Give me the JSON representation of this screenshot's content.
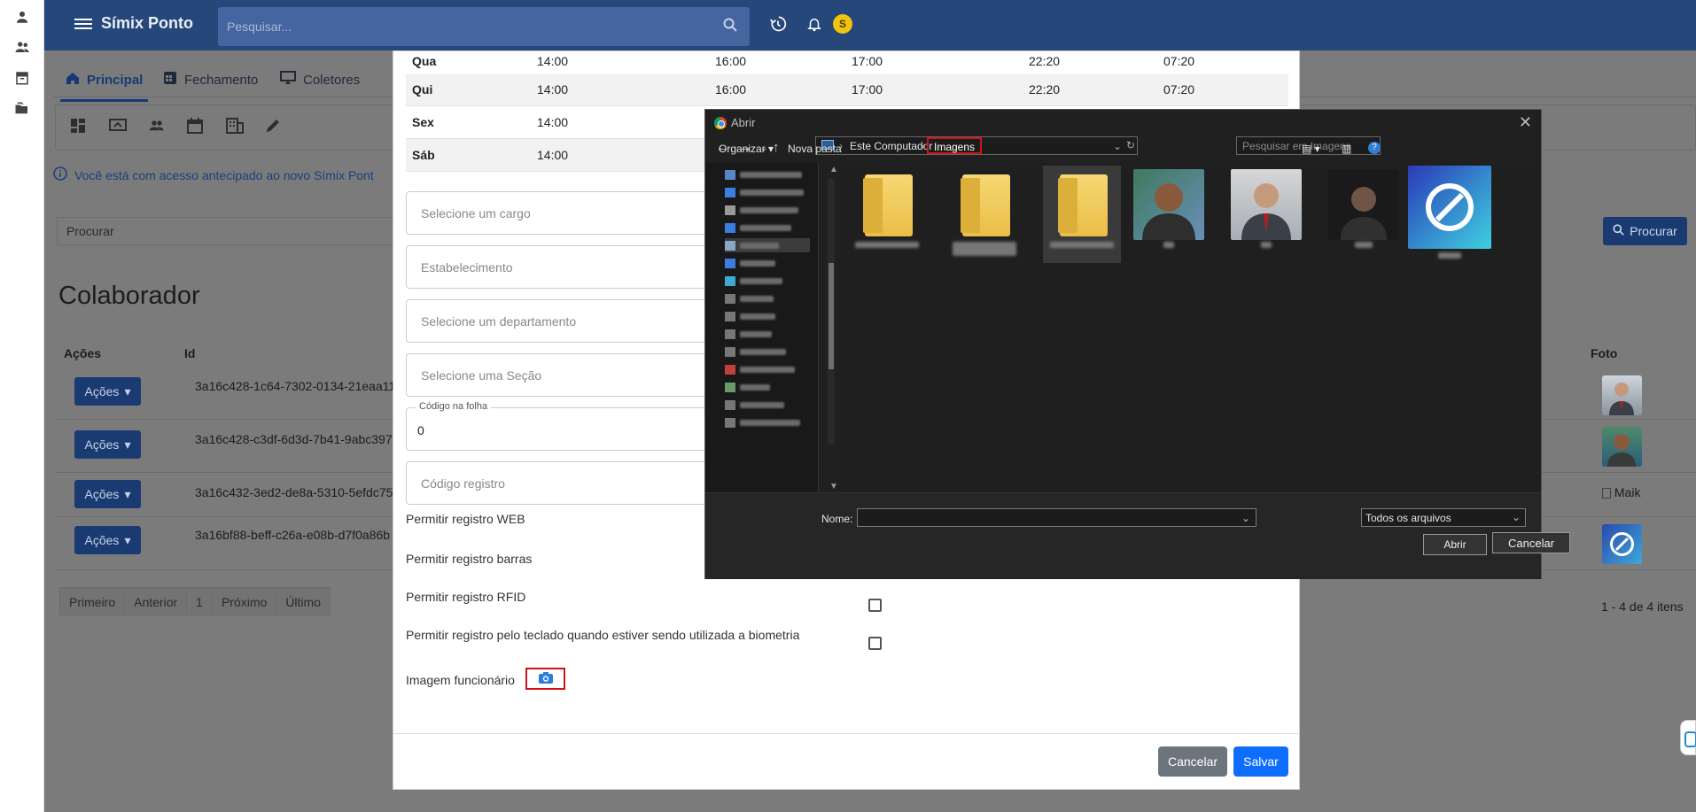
{
  "rail": {
    "icons": [
      "person-icon",
      "people-icon",
      "archive-icon",
      "folders-icon"
    ]
  },
  "topbar": {
    "brand": "Símix Ponto",
    "search_placeholder": "Pesquisar...",
    "avatar_letter": "S",
    "brand_color": "#25477a"
  },
  "tabs": [
    {
      "label": "Principal",
      "icon": "home-icon",
      "active": true
    },
    {
      "label": "Fechamento",
      "icon": "calendar-grid-icon"
    },
    {
      "label": "Coletores",
      "icon": "monitor-icon"
    }
  ],
  "banner": {
    "text": "Você está com acesso antecipado ao novo Símix Pont"
  },
  "list": {
    "search_placeholder": "Procurar",
    "search_button": "Procurar",
    "title": "Colaborador",
    "columns": {
      "acoes": "Ações",
      "id": "Id",
      "foto": "Foto"
    },
    "rows": [
      {
        "action": "Ações",
        "id": "3a16c428-1c64-7302-0134-21eaa11",
        "foto": "photo"
      },
      {
        "action": "Ações",
        "id": "3a16c428-c3df-6d3d-7b41-9abc397",
        "foto": "photo"
      },
      {
        "action": "Ações",
        "id": "3a16c432-3ed2-de8a-5310-5efdc75",
        "foto_alt": "Maik"
      },
      {
        "action": "Ações",
        "id": "3a16bf88-beff-c26a-e08b-d7f0a86b",
        "foto": "logo"
      }
    ],
    "pager": [
      "Primeiro",
      "Anterior",
      "1",
      "Próximo",
      "Último"
    ],
    "count": "1 - 4 de 4 itens"
  },
  "modal": {
    "schedule": [
      {
        "day": "Qua",
        "t1": "14:00",
        "t2": "16:00",
        "t3": "17:00",
        "t4": "22:20",
        "t5": "07:20"
      },
      {
        "day": "Qui",
        "t1": "14:00",
        "t2": "16:00",
        "t3": "17:00",
        "t4": "22:20",
        "t5": "07:20"
      },
      {
        "day": "Sex",
        "t1": "14:00"
      },
      {
        "day": "Sáb",
        "t1": "14:00"
      }
    ],
    "fields": {
      "cargo": "Selecione um cargo",
      "estabelecimento": "Estabelecimento",
      "departamento": "Selecione um departamento",
      "secao": "Selecione uma Seção",
      "codigo_folha_label": "Código na folha",
      "codigo_folha_value": "0",
      "codigo_registro": "Código registro"
    },
    "permissions": {
      "web": "Permitir registro WEB",
      "barras": "Permitir registro barras",
      "rfid": "Permitir registro RFID",
      "teclado": "Permitir registro pelo teclado quando estiver sendo utilizada a biometria"
    },
    "image_label": "Imagem funcionário",
    "cancel": "Cancelar",
    "save": "Salvar"
  },
  "dialog": {
    "title": "Abrir",
    "breadcrumb": [
      "Este Computador",
      "Imagens"
    ],
    "search_placeholder": "Pesquisar em Imagens",
    "organize": "Organizar",
    "new_folder": "Nova pasta",
    "nome_label": "Nome:",
    "nome_value": "",
    "filter": "Todos os arquivos",
    "open": "Abrir",
    "cancel": "Cancelar"
  }
}
